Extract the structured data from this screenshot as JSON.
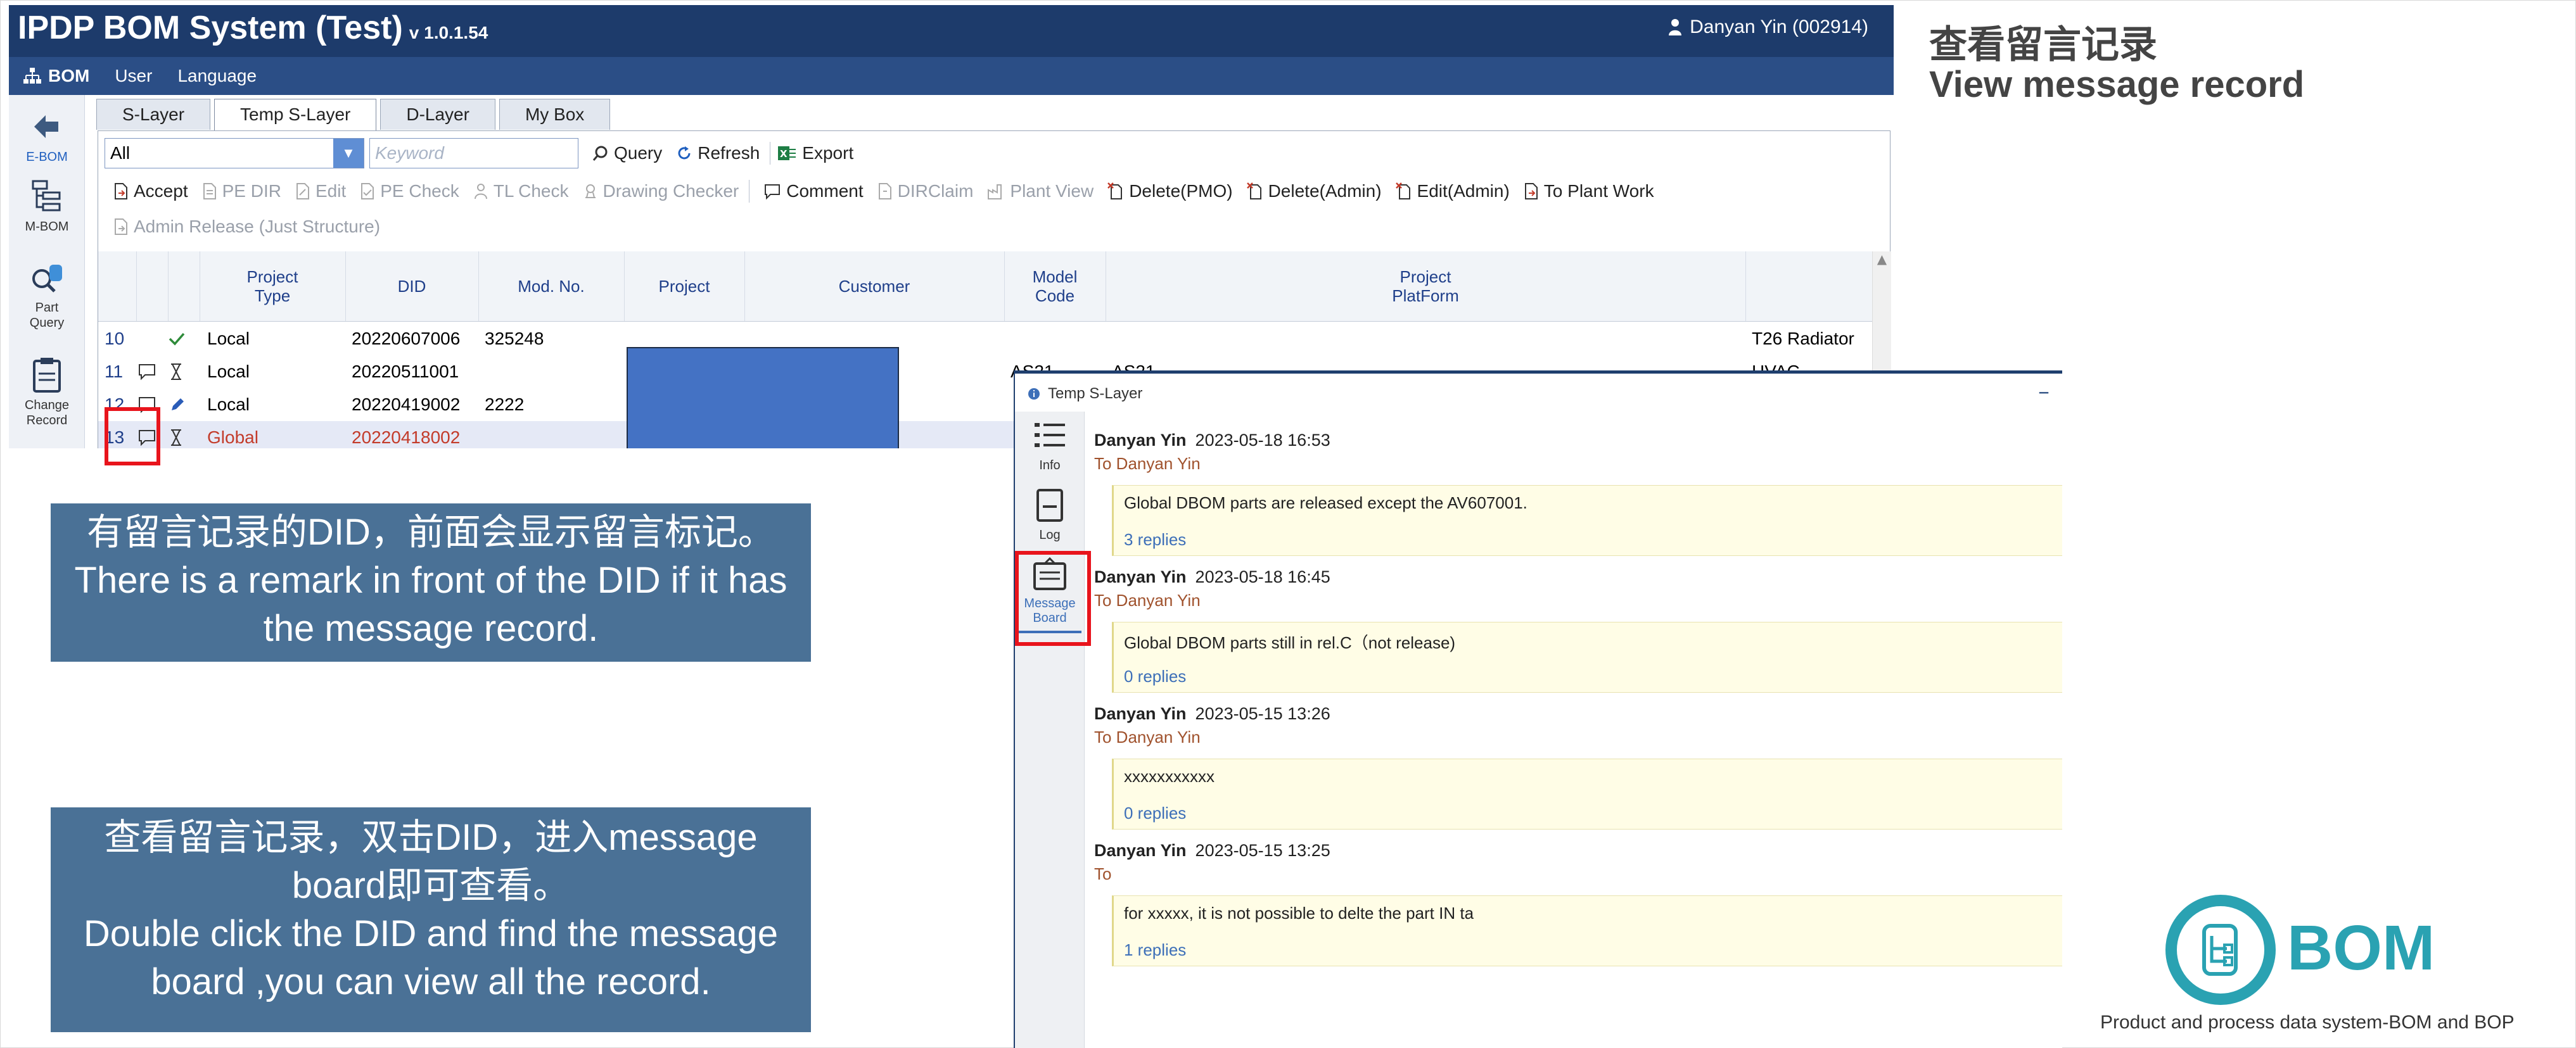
{
  "app": {
    "title": "IPDP BOM System (Test)",
    "version": "v 1.0.1.54",
    "user": "Danyan Yin (002914)"
  },
  "menu": {
    "bom": "BOM",
    "user": "User",
    "language": "Language"
  },
  "leftnav": {
    "ebom": "E-BOM",
    "mbom": "M-BOM",
    "part_query_1": "Part",
    "part_query_2": "Query",
    "change_record_1": "Change",
    "change_record_2": "Record"
  },
  "tabs": [
    "S-Layer",
    "Temp S-Layer",
    "D-Layer",
    "My Box"
  ],
  "search": {
    "filter_value": "All",
    "keyword_placeholder": "Keyword",
    "query": "Query",
    "refresh": "Refresh",
    "export": "Export"
  },
  "toolbar1": {
    "accept": "Accept",
    "pe_dir": "PE DIR",
    "edit": "Edit",
    "pe_check": "PE Check",
    "tl_check": "TL Check",
    "drawing_checker": "Drawing Checker",
    "comment": "Comment",
    "dirclaim": "DIRClaim",
    "plant_view": "Plant View",
    "delete_pmo": "Delete(PMO)",
    "delete_admin": "Delete(Admin)",
    "edit_admin": "Edit(Admin)",
    "to_plant_work": "To Plant Work"
  },
  "toolbar2": {
    "admin_release": "Admin Release (Just Structure)"
  },
  "grid": {
    "headers": {
      "project_type_1": "Project",
      "project_type_2": "Type",
      "did": "DID",
      "mod_no": "Mod. No.",
      "project": "Project",
      "customer": "Customer",
      "model_code_1": "Model",
      "model_code_2": "Code",
      "platform_1": "Project",
      "platform_2": "PlatForm"
    },
    "rows": [
      {
        "num": "10",
        "type": "Local",
        "did": "20220607006",
        "mod": "325248",
        "model": "",
        "platform": "",
        "extra": "T26 Radiator"
      },
      {
        "num": "11",
        "type": "Local",
        "did": "20220511001",
        "mod": "",
        "model": "AS21",
        "platform": "AS21",
        "extra": "HVAC"
      },
      {
        "num": "12",
        "type": "Local",
        "did": "20220419002",
        "mod": "2222",
        "model": "",
        "platform": "",
        "extra": ""
      },
      {
        "num": "13",
        "type": "Global",
        "did": "20220418002",
        "mod": "",
        "model": "",
        "platform": "",
        "extra": ""
      }
    ]
  },
  "callout1": {
    "line1": "有留言记录的DID，前面会显示留言标记。",
    "line2": "There is a remark in front of the DID if it has",
    "line3": "the message record."
  },
  "callout2": {
    "line1": "查看留言记录，双击DID，进入message",
    "line2": "board即可查看。",
    "line3": "Double click the DID and find the message",
    "line4": "board ,you can view all the record."
  },
  "message_window": {
    "title": "Temp S-Layer",
    "sidebar": {
      "info": "Info",
      "log": "Log",
      "board_1": "Message",
      "board_2": "Board"
    },
    "messages": [
      {
        "author": "Danyan Yin",
        "time": "2023-05-18 16:53",
        "to": "To Danyan Yin",
        "text": "Global DBOM parts are released except the AV607001.",
        "replies": "3 replies"
      },
      {
        "author": "Danyan Yin",
        "time": "2023-05-18 16:45",
        "to": "To Danyan Yin",
        "text": "Global DBOM parts still in rel.C（not release)",
        "replies": "0 replies"
      },
      {
        "author": "Danyan Yin",
        "time": "2023-05-15 13:26",
        "to": "To Danyan Yin",
        "text": "xxxxxxxxxxx",
        "replies": "0 replies"
      },
      {
        "author": "Danyan Yin",
        "time": "2023-05-15 13:25",
        "to": "To",
        "text": "for xxxxx,  it is not possible to delte the part IN ta",
        "replies": "1 replies"
      }
    ]
  },
  "right": {
    "title_cn": "查看留言记录",
    "title_en": "View message record",
    "logo_text": "BOM",
    "tagline": "Product and process data system-BOM and BOP"
  },
  "colors": {
    "titlebar": "#1d3b6b",
    "menubar": "#2b4e86",
    "callout": "#4a7196",
    "highlight": "#e8141c",
    "logo": "#2aa2b2"
  }
}
